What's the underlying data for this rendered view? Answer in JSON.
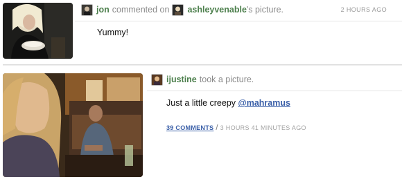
{
  "item1": {
    "actor": "jon",
    "action_text": "commented on",
    "target_user": "ashleyvenable",
    "target_suffix": "'s picture.",
    "time": "2 HOURS AGO",
    "comment": "Yummy!"
  },
  "item2": {
    "actor": "ijustine",
    "action_text": "took a picture.",
    "caption_text": "Just a little creepy",
    "mention": "@mahramus",
    "comments_link": "39 COMMENTS",
    "separator": "/",
    "time": "3 HOURS 41 MINUTES AGO"
  },
  "colors": {
    "username_green": "#4c7f4c",
    "link_blue": "#3a5fa8",
    "meta_gray": "#a3a3a3"
  }
}
